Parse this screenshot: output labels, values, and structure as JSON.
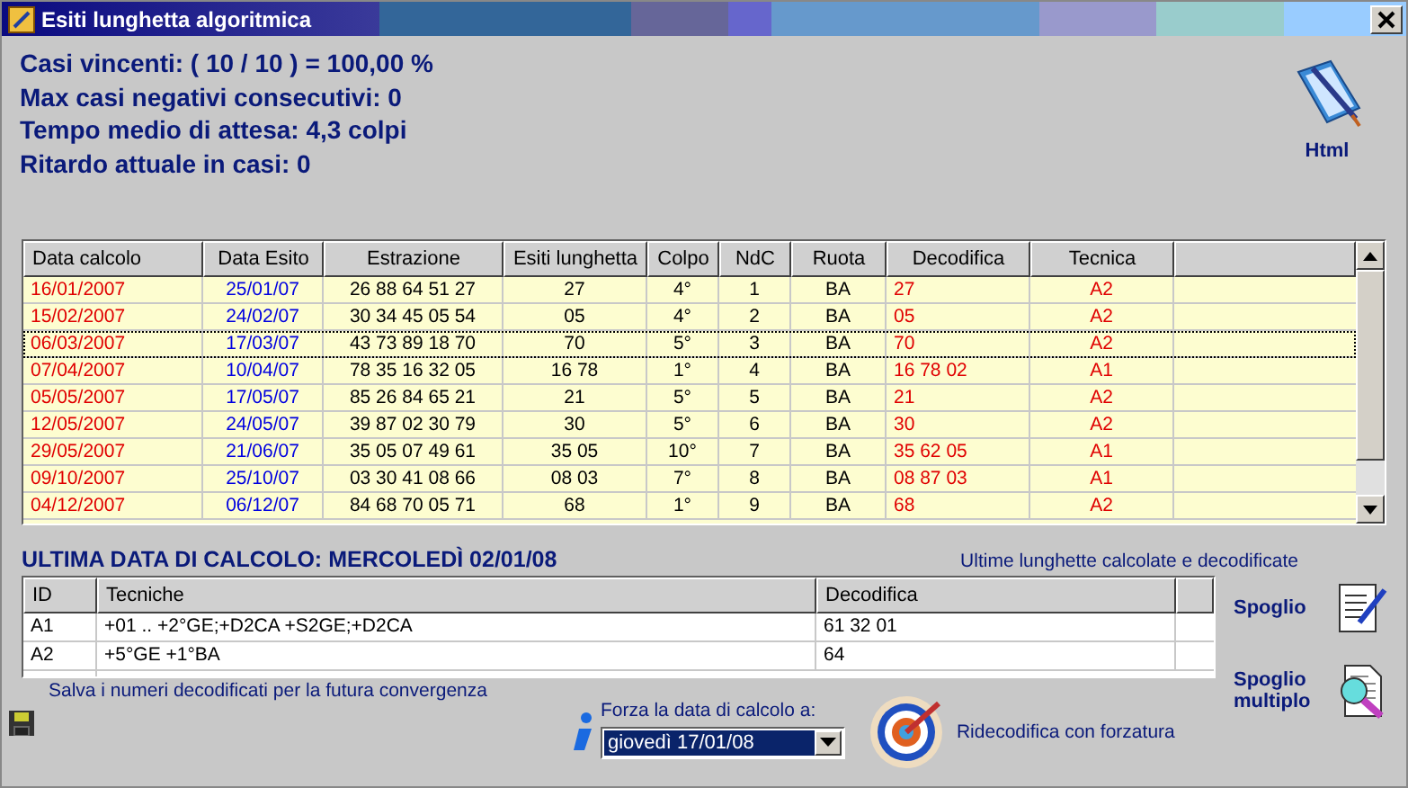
{
  "window": {
    "title": "Esiti lunghetta algoritmica"
  },
  "stats": [
    "Casi vincenti: ( 10 / 10 ) = 100,00 %",
    "Max casi negativi consecutivi: 0",
    "Tempo medio di attesa: 4,3 colpi",
    "Ritardo attuale in casi: 0"
  ],
  "html_button": {
    "label": "Html"
  },
  "table": {
    "columns": [
      "Data calcolo",
      "Data Esito",
      "Estrazione",
      "Esiti lunghetta",
      "Colpo",
      "NdC",
      "Ruota",
      "Decodifica",
      "Tecnica"
    ],
    "rows": [
      {
        "cells": [
          "16/01/2007",
          "25/01/07",
          "26 88 64 51 27",
          "27",
          "4°",
          "1",
          "BA",
          "27",
          "A2"
        ],
        "focused": false
      },
      {
        "cells": [
          "15/02/2007",
          "24/02/07",
          "30 34 45 05 54",
          "05",
          "4°",
          "2",
          "BA",
          "05",
          "A2"
        ],
        "focused": false
      },
      {
        "cells": [
          "06/03/2007",
          "17/03/07",
          "43 73 89 18 70",
          "70",
          "5°",
          "3",
          "BA",
          "70",
          "A2"
        ],
        "focused": true
      },
      {
        "cells": [
          "07/04/2007",
          "10/04/07",
          "78 35 16 32 05",
          "16 78",
          "1°",
          "4",
          "BA",
          "16 78 02",
          "A1"
        ],
        "focused": false
      },
      {
        "cells": [
          "05/05/2007",
          "17/05/07",
          "85 26 84 65 21",
          "21",
          "5°",
          "5",
          "BA",
          "21",
          "A2"
        ],
        "focused": false
      },
      {
        "cells": [
          "12/05/2007",
          "24/05/07",
          "39 87 02 30 79",
          "30",
          "5°",
          "6",
          "BA",
          "30",
          "A2"
        ],
        "focused": false
      },
      {
        "cells": [
          "29/05/2007",
          "21/06/07",
          "35 05 07 49 61",
          "35 05",
          "10°",
          "7",
          "BA",
          "35 62 05",
          "A1"
        ],
        "focused": false
      },
      {
        "cells": [
          "09/10/2007",
          "25/10/07",
          "03 30 41 08 66",
          "08 03",
          "7°",
          "8",
          "BA",
          "08 87 03",
          "A1"
        ],
        "focused": false
      },
      {
        "cells": [
          "04/12/2007",
          "06/12/07",
          "84 68 70 05 71",
          "68",
          "1°",
          "9",
          "BA",
          "68",
          "A2"
        ],
        "focused": false
      }
    ]
  },
  "last_calc": "ULTIMA DATA DI CALCOLO: MERCOLEDÌ 02/01/08",
  "last_note": "Ultime lunghette calcolate e decodificate",
  "techniques": {
    "columns": [
      "ID",
      "Tecniche",
      "Decodifica"
    ],
    "rows": [
      [
        "A1",
        "+01 .. +2°GE;+D2CA +S2GE;+D2CA",
        "61 32 01"
      ],
      [
        "A2",
        "+5°GE +1°BA",
        "64"
      ]
    ]
  },
  "spoglio": {
    "label": "Spoglio"
  },
  "spoglio_multiplo": {
    "label": "Spoglio multiplo"
  },
  "save_link": "Salva i numeri decodificati per la futura convergenza",
  "force_label": "Forza la data di calcolo a:",
  "force_date": {
    "value": "giovedì 17/01/08"
  },
  "recode_link": "Ridecodifica con forzatura"
}
